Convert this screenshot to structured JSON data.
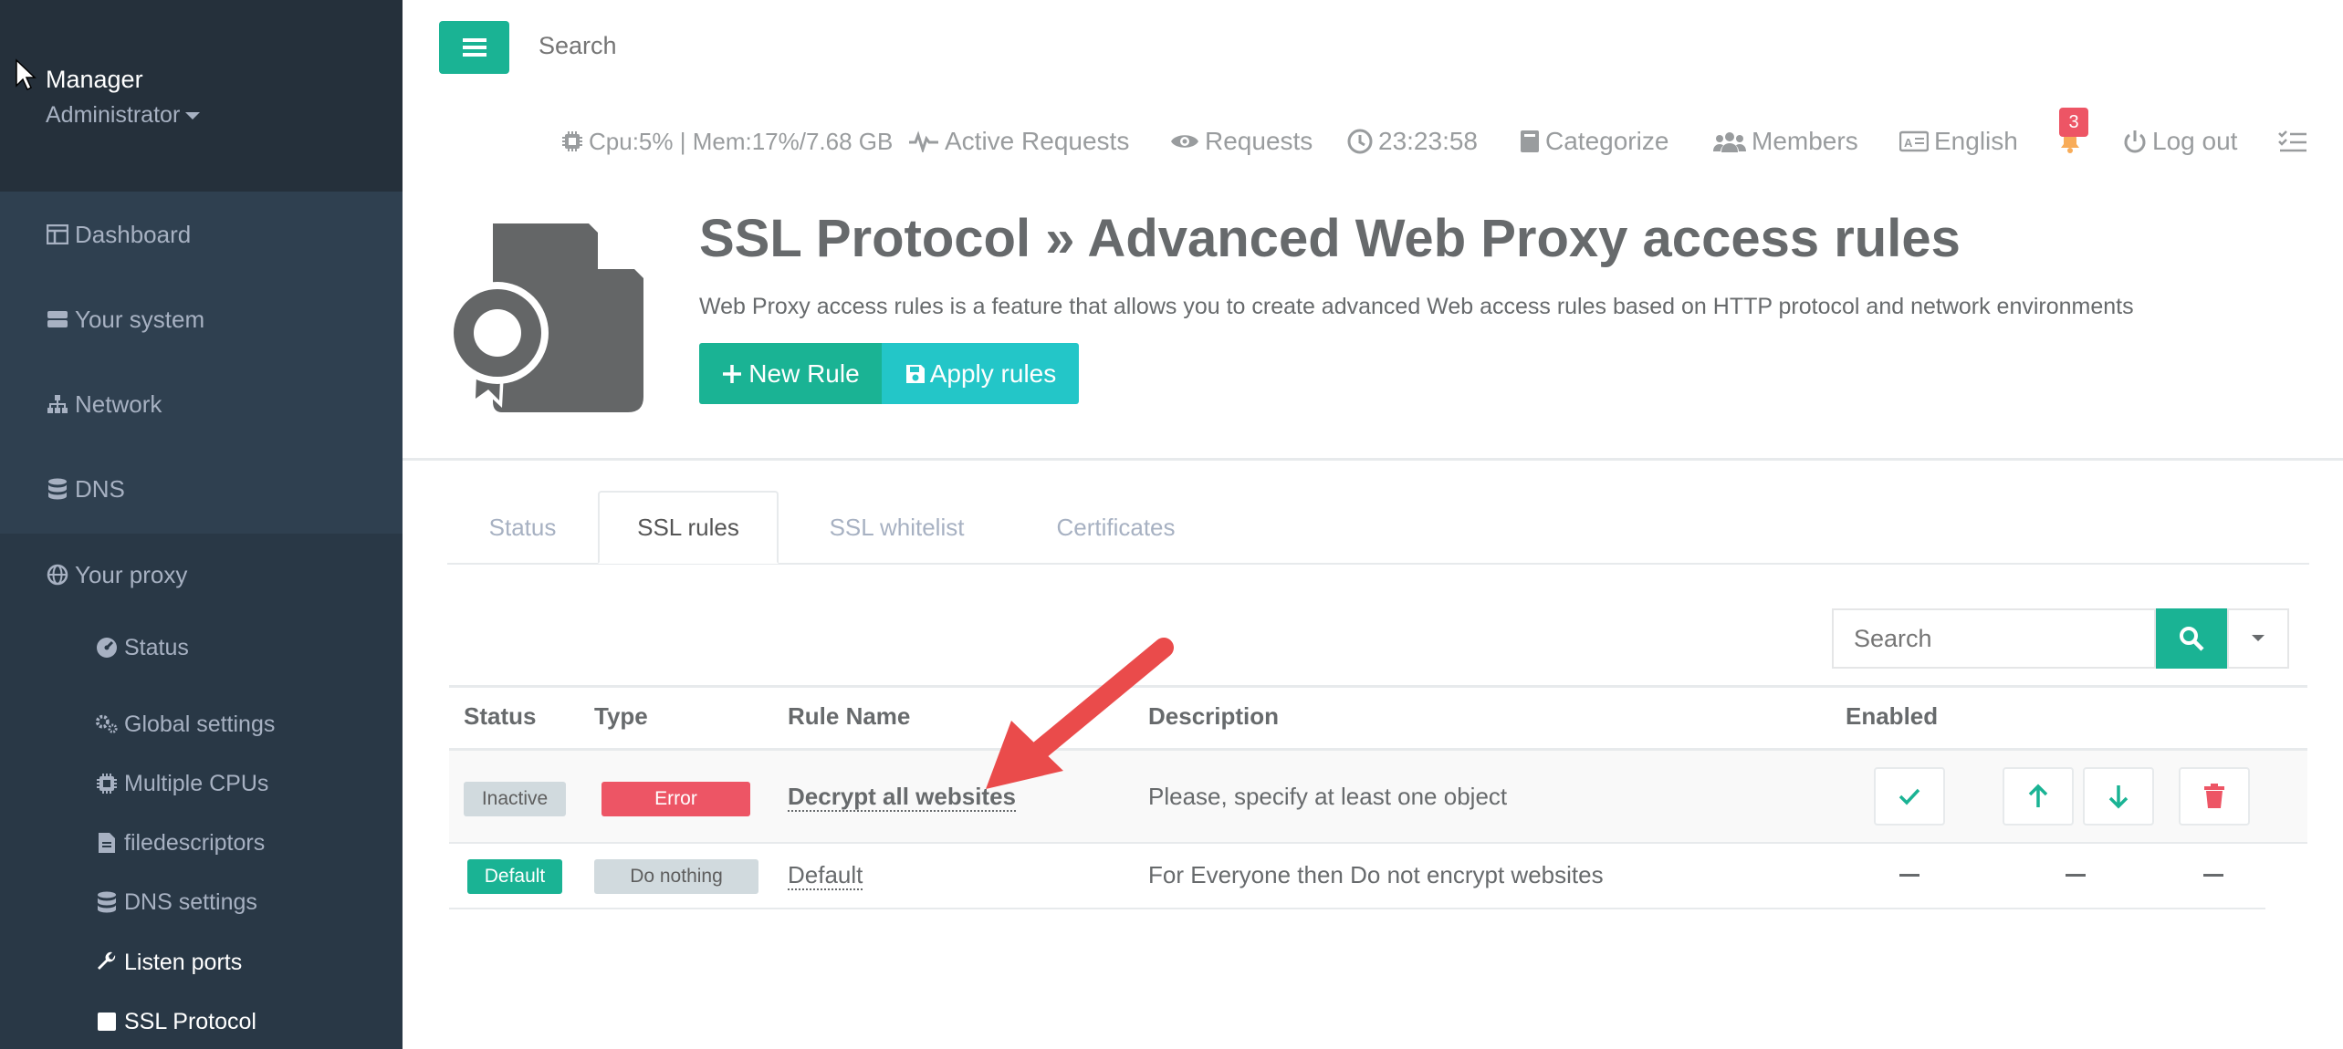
{
  "sidebar": {
    "profile_name": "Manager",
    "profile_role": "Administrator",
    "items": [
      {
        "label": "Dashboard",
        "icon": "dashboard-icon"
      },
      {
        "label": "Your system",
        "icon": "server-icon"
      },
      {
        "label": "Network",
        "icon": "sitemap-icon"
      },
      {
        "label": "DNS",
        "icon": "database-icon"
      },
      {
        "label": "Your proxy",
        "icon": "globe-icon"
      }
    ],
    "subitems": [
      {
        "label": "Status",
        "icon": "gauge-icon"
      },
      {
        "label": "Global settings",
        "icon": "cogs-icon"
      },
      {
        "label": "Multiple CPUs",
        "icon": "cpu-icon"
      },
      {
        "label": "filedescriptors",
        "icon": "file-icon"
      },
      {
        "label": "DNS settings",
        "icon": "database-icon"
      },
      {
        "label": "Listen ports",
        "icon": "wrench-icon"
      },
      {
        "label": "SSL Protocol",
        "icon": "square-icon"
      }
    ]
  },
  "topbar": {
    "search_placeholder": "Search",
    "cpu_mem": "Cpu:5% | Mem:17%/7.68 GB",
    "active_requests": "Active Requests",
    "requests": "Requests",
    "clock": "23:23:58",
    "categorize": "Categorize",
    "members": "Members",
    "language": "English",
    "notification_count": "3",
    "logout": "Log out"
  },
  "header": {
    "title": "SSL Protocol » Advanced Web Proxy access rules",
    "subtitle": "Web Proxy access rules is a feature that allows you to create advanced Web access rules based on HTTP protocol and network environments",
    "new_rule": "New Rule",
    "apply_rules": "Apply rules"
  },
  "tabs": [
    {
      "label": "Status"
    },
    {
      "label": "SSL rules"
    },
    {
      "label": "SSL whitelist"
    },
    {
      "label": "Certificates"
    }
  ],
  "table": {
    "search_placeholder": "Search",
    "columns": [
      "Status",
      "Type",
      "Rule Name",
      "Description",
      "Enabled"
    ],
    "rows": [
      {
        "status": "Inactive",
        "type": "Error",
        "name": "Decrypt all websites",
        "description": "Please, specify at least one object"
      },
      {
        "status": "Default",
        "type": "Do nothing",
        "name": "Default",
        "description": "For Everyone then Do not encrypt websites"
      }
    ]
  },
  "colors": {
    "sidebar_bg": "#2f4050",
    "primary": "#1ab394",
    "info": "#23c6c8",
    "danger": "#ed5565",
    "arrow": "#ea4b4b"
  }
}
